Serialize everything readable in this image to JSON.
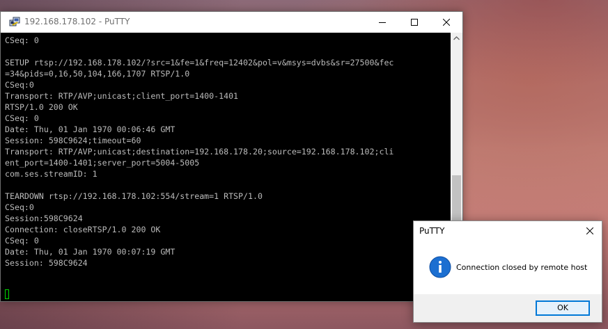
{
  "window": {
    "title": "192.168.178.102 - PuTTY",
    "icon": "putty-icon",
    "buttons": [
      "minimize-icon",
      "maximize-icon",
      "close-icon"
    ]
  },
  "terminal": {
    "lines": [
      "CSeq: 0",
      "",
      "SETUP rtsp://192.168.178.102/?src=1&fe=1&freq=12402&pol=v&msys=dvbs&sr=27500&fec",
      "=34&pids=0,16,50,104,166,1707 RTSP/1.0",
      "CSeq:0",
      "Transport: RTP/AVP;unicast;client_port=1400-1401",
      "RTSP/1.0 200 OK",
      "CSeq: 0",
      "Date: Thu, 01 Jan 1970 00:06:46 GMT",
      "Session: 598C9624;timeout=60",
      "Transport: RTP/AVP;unicast;destination=192.168.178.20;source=192.168.178.102;cli",
      "ent_port=1400-1401;server_port=5004-5005",
      "com.ses.streamID: 1",
      "",
      "TEARDOWN rtsp://192.168.178.102:554/stream=1 RTSP/1.0",
      "CSeq:0",
      "Session:598C9624",
      "Connection: closeRTSP/1.0 200 OK",
      "CSeq: 0",
      "Date: Thu, 01 Jan 1970 00:07:19 GMT",
      "Session: 598C9624"
    ],
    "text_color": "#bbbbbb",
    "background": "#000000",
    "cursor_color": "#00d800"
  },
  "dialog": {
    "title": "PuTTY",
    "icon": "info-icon",
    "message": "Connection closed by remote host",
    "ok_label": "OK",
    "accent": "#0078d7"
  }
}
